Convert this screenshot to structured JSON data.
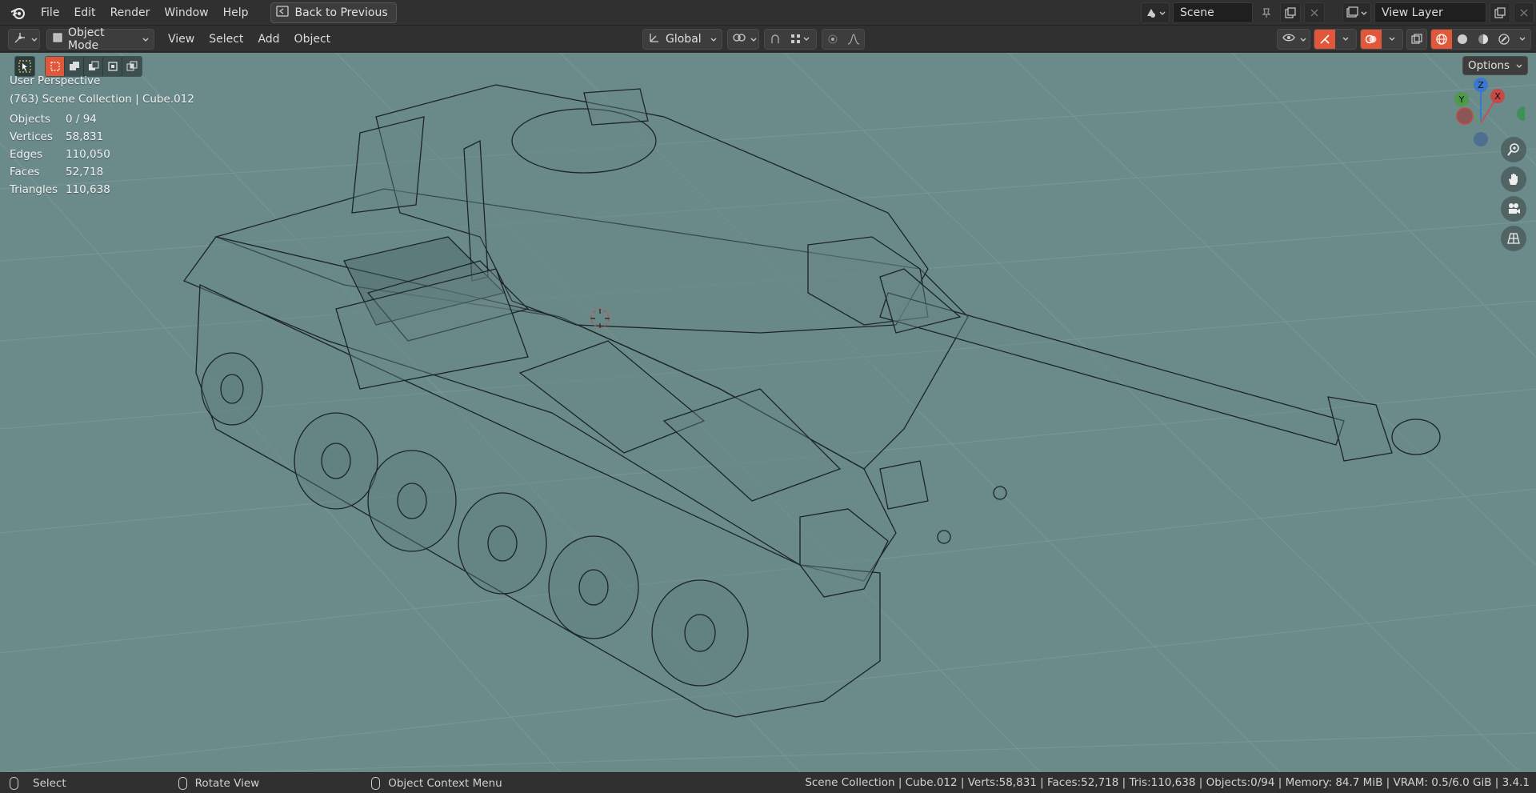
{
  "menubar": {
    "items": [
      "File",
      "Edit",
      "Render",
      "Window",
      "Help"
    ],
    "back_button": "Back to Previous",
    "scene_name": "Scene",
    "view_layer": "View Layer"
  },
  "header": {
    "mode": "Object Mode",
    "menus": [
      "View",
      "Select",
      "Add",
      "Object"
    ],
    "orientation": "Global"
  },
  "viewport": {
    "perspective": "User Perspective",
    "collection_info": "(763) Scene Collection | Cube.012",
    "options_label": "Options",
    "stats": [
      {
        "label": "Objects",
        "value": "0 / 94"
      },
      {
        "label": "Vertices",
        "value": "58,831"
      },
      {
        "label": "Edges",
        "value": "110,050"
      },
      {
        "label": "Faces",
        "value": "52,718"
      },
      {
        "label": "Triangles",
        "value": "110,638"
      }
    ],
    "gizmo": {
      "x": "X",
      "y": "Y",
      "z": "Z"
    },
    "background_color": "#6b8a8a",
    "wire_color": "#1c2424"
  },
  "statusbar": {
    "select": "Select",
    "rotate": "Rotate View",
    "context": "Object Context Menu",
    "info": "Scene Collection | Cube.012 | Verts:58,831 | Faces:52,718 | Tris:110,638 | Objects:0/94 | Memory: 84.7 MiB | VRAM: 0.5/6.0 GiB | 3.4.1"
  },
  "icons": {
    "blender_logo": "blender-logo-icon",
    "accent": "#e0573a",
    "accent_blue": "#4772b3"
  }
}
